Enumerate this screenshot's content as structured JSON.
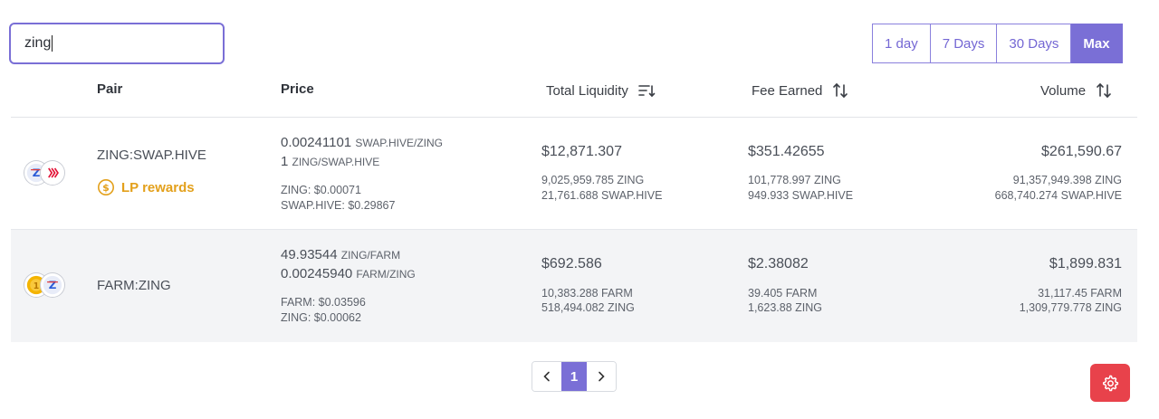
{
  "search": {
    "value": "zing"
  },
  "range": {
    "options": [
      "1 day",
      "7 Days",
      "30 Days",
      "Max"
    ],
    "active": "Max"
  },
  "columns": {
    "pair": "Pair",
    "price": "Price",
    "liquidity": "Total Liquidity",
    "fee": "Fee Earned",
    "volume": "Volume"
  },
  "rows": [
    {
      "pair": "ZING:SWAP.HIVE",
      "lp_rewards": "LP rewards",
      "price1_value": "0.00241101",
      "price1_unit": "SWAP.HIVE/ZING",
      "price2_value": "1",
      "price2_unit": "ZING/SWAP.HIVE",
      "usd1": "ZING: $0.00071",
      "usd2": "SWAP.HIVE: $0.29867",
      "liquidity_total": "$12,871.307",
      "liquidity_a": "9,025,959.785 ZING",
      "liquidity_b": "21,761.688 SWAP.HIVE",
      "fee_total": "$351.42655",
      "fee_a": "101,778.997 ZING",
      "fee_b": "949.933 SWAP.HIVE",
      "volume_total": "$261,590.67",
      "volume_a": "91,357,949.398 ZING",
      "volume_b": "668,740.274 SWAP.HIVE"
    },
    {
      "pair": "FARM:ZING",
      "price1_value": "49.93544",
      "price1_unit": "ZING/FARM",
      "price2_value": "0.00245940",
      "price2_unit": "FARM/ZING",
      "usd1": "FARM: $0.03596",
      "usd2": "ZING: $0.00062",
      "liquidity_total": "$692.586",
      "liquidity_a": "10,383.288 FARM",
      "liquidity_b": "518,494.082 ZING",
      "fee_total": "$2.38082",
      "fee_a": "39.405 FARM",
      "fee_b": "1,623.88 ZING",
      "volume_total": "$1,899.831",
      "volume_a": "31,117.45 FARM",
      "volume_b": "1,309,779.778 ZING"
    }
  ],
  "pagination": {
    "current": "1"
  },
  "colors": {
    "accent": "#7a6fd6",
    "lp_rewards": "#e3a01b",
    "settings": "#e8424b"
  }
}
